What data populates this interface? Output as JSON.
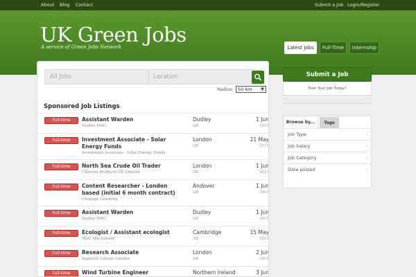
{
  "topnav": {
    "left": [
      "About",
      "Blog",
      "Contact"
    ],
    "right": [
      "Submit a Job",
      "Login/Register"
    ]
  },
  "header": {
    "title": "UK Green Jobs",
    "tagline": "A service of Green Jobs Network",
    "tabs": [
      {
        "label": "Latest Jobs",
        "active": true
      },
      {
        "label": "Full-Time",
        "active": false
      },
      {
        "label": "Internship",
        "active": false
      }
    ]
  },
  "search": {
    "keywords_placeholder": "All Jobs",
    "location_placeholder": "Location",
    "radius_label": "Radius:",
    "radius_value": "50 km"
  },
  "listing": {
    "title": "Sponsored Job Listings",
    "jobs": [
      {
        "type": "Full-time",
        "title": "Assistant Warden",
        "company": "Dudley MBC",
        "location": "Dudley",
        "country": "GB",
        "day": "1 Jun",
        "year": "2015"
      },
      {
        "type": "Full-time",
        "title": "Investment Associate - Solar Energy Funds",
        "company": "Investment Associate - Solar Energy Funds",
        "location": "London",
        "country": "GB",
        "day": "21 May",
        "year": "2015"
      },
      {
        "type": "Full-time",
        "title": "North Sea Crude Oil Trader",
        "company": "Chevron Products UK Limited",
        "location": "London",
        "country": "GB",
        "day": "1 Jun",
        "year": "2015"
      },
      {
        "type": "Full-time",
        "title": "Content Researcher - London based (initial 6 month contract)",
        "company": "Cengage Learning",
        "location": "Andover",
        "country": "GB",
        "day": "1 Jun",
        "year": "2015"
      },
      {
        "type": "Full-time",
        "title": "Assistant Warden",
        "company": "Dudley MBC",
        "location": "Dudley",
        "country": "GB",
        "day": "1 Jun",
        "year": "2015"
      },
      {
        "type": "Full-time",
        "title": "Ecologist / Assistant ecologist",
        "company": "Mott MacDonald",
        "location": "Cambridge",
        "country": "GB",
        "day": "15 May",
        "year": "2015"
      },
      {
        "type": "Full-time",
        "title": "Research Associate",
        "company": "Imperial College London",
        "location": "London",
        "country": "GB",
        "day": "2 Jun",
        "year": "2015"
      },
      {
        "type": "Full-time",
        "title": "Wind Turbine Engineer",
        "company": "",
        "location": "Northern Ireland",
        "country": "",
        "day": "3 Jun",
        "year": ""
      }
    ]
  },
  "sidebar": {
    "submit_label": "Submit a Job",
    "submit_sub": "Post Your Job Today!",
    "tabs": [
      "Browse by...",
      "Tags"
    ],
    "items": [
      "Job Type",
      "Job Salary",
      "Job Category",
      "Date posted"
    ]
  },
  "colors": {
    "brand_green": "#3f7a1f",
    "header_green": "#4a8625",
    "topbar": "#2b4a12",
    "badge_red": "#d9534f"
  },
  "icons": {
    "search_button": "search-icon",
    "sidebar_chevron": "chevron-right-icon"
  }
}
